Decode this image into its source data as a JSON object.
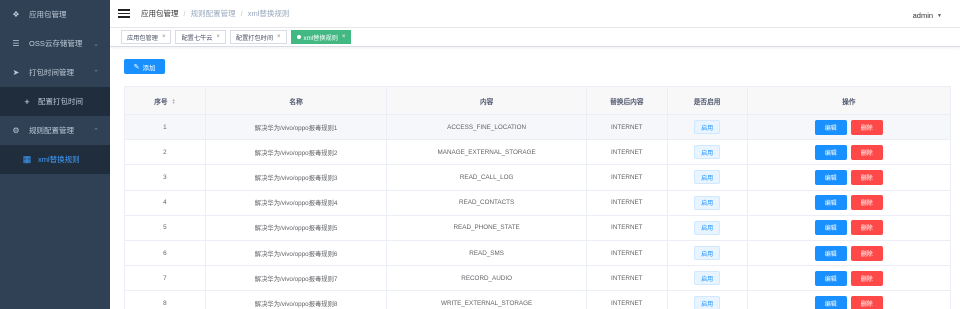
{
  "sidebar": {
    "items": [
      {
        "label": "应用包管理",
        "icon": "apps-icon"
      },
      {
        "label": "OSS云存储管理",
        "icon": "list-icon"
      },
      {
        "label": "打包时间管理",
        "icon": "send-icon"
      },
      {
        "label": "配置打包时间",
        "icon": "plus-icon"
      },
      {
        "label": "规则配置管理",
        "icon": "gear-icon"
      },
      {
        "label": "xml替换规则",
        "icon": "file-icon"
      }
    ]
  },
  "breadcrumb": [
    "应用包管理",
    "规则配置管理",
    "xml替换规则"
  ],
  "user": {
    "name": "admin"
  },
  "tags": [
    {
      "label": "应用包管理"
    },
    {
      "label": "配置七牛云"
    },
    {
      "label": "配置打包时间"
    },
    {
      "label": "xml替换规则"
    }
  ],
  "toolbar": {
    "add_label": "添加"
  },
  "table": {
    "headers": [
      "序号",
      "名称",
      "内容",
      "替换后内容",
      "是否启用",
      "操作"
    ],
    "rows": [
      {
        "no": "1",
        "name": "解决华为/vivo/oppo报毒规则1",
        "content": "ACCESS_FINE_LOCATION",
        "replace": "INTERNET",
        "enabled": "启用"
      },
      {
        "no": "2",
        "name": "解决华为/vivo/oppo报毒规则2",
        "content": "MANAGE_EXTERNAL_STORAGE",
        "replace": "INTERNET",
        "enabled": "启用"
      },
      {
        "no": "3",
        "name": "解决华为/vivo/oppo报毒规则3",
        "content": "READ_CALL_LOG",
        "replace": "INTERNET",
        "enabled": "启用"
      },
      {
        "no": "4",
        "name": "解决华为/vivo/oppo报毒规则4",
        "content": "READ_CONTACTS",
        "replace": "INTERNET",
        "enabled": "启用"
      },
      {
        "no": "5",
        "name": "解决华为/vivo/oppo报毒规则5",
        "content": "READ_PHONE_STATE",
        "replace": "INTERNET",
        "enabled": "启用"
      },
      {
        "no": "6",
        "name": "解决华为/vivo/oppo报毒规则6",
        "content": "READ_SMS",
        "replace": "INTERNET",
        "enabled": "启用"
      },
      {
        "no": "7",
        "name": "解决华为/vivo/oppo报毒规则7",
        "content": "RECORD_AUDIO",
        "replace": "INTERNET",
        "enabled": "启用"
      },
      {
        "no": "8",
        "name": "解决华为/vivo/oppo报毒规则8",
        "content": "WRITE_EXTERNAL_STORAGE",
        "replace": "INTERNET",
        "enabled": "启用"
      }
    ],
    "actions": {
      "edit": "编辑",
      "delete": "删除"
    }
  },
  "colors": {
    "sidebar_bg": "#304156",
    "active_tag": "#42b983",
    "primary": "#1890ff",
    "danger": "#ff4949",
    "active_menu": "#409eff"
  }
}
